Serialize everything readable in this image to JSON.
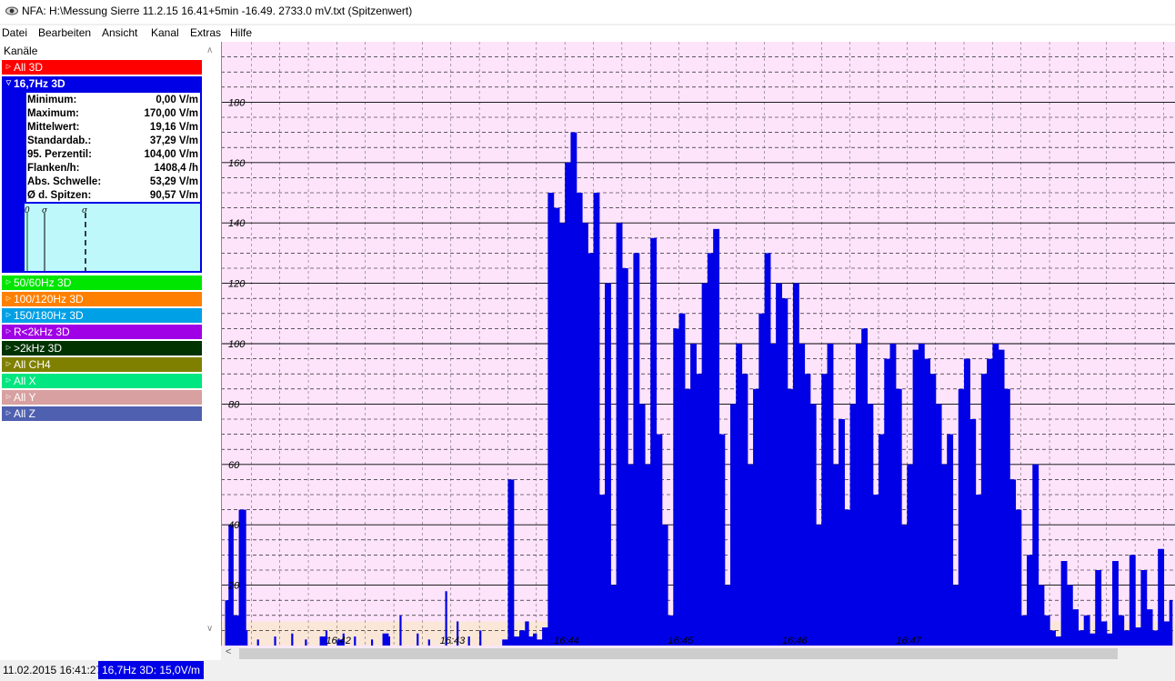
{
  "window": {
    "title": "NFA: H:\\Messung Sierre 11.2.15 16.41+5min -16.49. 2733.0 mV.txt (Spitzenwert)"
  },
  "menu": [
    "Datei",
    "Bearbeiten",
    "Ansicht",
    "Kanal",
    "Extras",
    "Hilfe"
  ],
  "panel": {
    "title": "Kanäle"
  },
  "channels": [
    {
      "label": "All 3D",
      "color": "#ff0000",
      "text_color": "#ffffff",
      "expanded": false
    },
    {
      "label": "16,7Hz 3D",
      "color": "#0000e6",
      "text_color": "#ffffff",
      "expanded": true
    },
    {
      "label": "50/60Hz 3D",
      "color": "#00e600",
      "text_color": "#ffffff",
      "expanded": false
    },
    {
      "label": "100/120Hz 3D",
      "color": "#ff8000",
      "text_color": "#ffffff",
      "expanded": false
    },
    {
      "label": "150/180Hz 3D",
      "color": "#00a0e6",
      "text_color": "#ffffff",
      "expanded": false
    },
    {
      "label": "R<2kHz 3D",
      "color": "#a000e6",
      "text_color": "#ffffff",
      "expanded": false
    },
    {
      "label": ">2kHz 3D",
      "color": "#003300",
      "text_color": "#ffffff",
      "expanded": false
    },
    {
      "label": "All CH4",
      "color": "#808000",
      "text_color": "#ffffff",
      "expanded": false
    },
    {
      "label": "All X",
      "color": "#00e680",
      "text_color": "#ffffff",
      "expanded": false
    },
    {
      "label": "All Y",
      "color": "#d8a0a0",
      "text_color": "#ffffff",
      "expanded": false
    },
    {
      "label": "All Z",
      "color": "#5060b0",
      "text_color": "#ffffff",
      "expanded": false
    }
  ],
  "stats": [
    {
      "label": "Minimum:",
      "value": "0,00 V/m"
    },
    {
      "label": "Maximum:",
      "value": "170,00 V/m"
    },
    {
      "label": "Mittelwert:",
      "value": "19,16 V/m"
    },
    {
      "label": "Standardab.:",
      "value": "37,29 V/m"
    },
    {
      "label": "95. Perzentil:",
      "value": "104,00 V/m"
    },
    {
      "label": "Flanken/h:",
      "value": "1408,4 /h"
    },
    {
      "label": "Abs. Schwelle:",
      "value": "53,29 V/m"
    },
    {
      "label": "Ø d. Spitzen:",
      "value": "90,57 V/m"
    }
  ],
  "histogram_labels": [
    "0",
    "σ",
    "σ"
  ],
  "chart_data": {
    "type": "area",
    "title": "",
    "xlabel": "",
    "ylabel": "",
    "ylim": [
      0,
      200
    ],
    "yticks": [
      20,
      40,
      60,
      80,
      100,
      120,
      140,
      160,
      180
    ],
    "xticks": [
      "16:42",
      "16:43",
      "16:44",
      "16:45",
      "16:46",
      "16:47"
    ],
    "series": [
      {
        "name": "16,7Hz 3D",
        "color": "#0000e6",
        "x_minutes_since_16_41": [
          0.02,
          0.05,
          0.09,
          0.14,
          0.2,
          0.3,
          0.45,
          0.6,
          0.72,
          0.85,
          0.9,
          1.0,
          1.05,
          1.15,
          1.3,
          1.4,
          1.45,
          1.55,
          1.7,
          1.8,
          1.95,
          2.05,
          2.15,
          2.25,
          2.45,
          2.5,
          2.55,
          2.6,
          2.65,
          2.68,
          2.72,
          2.75,
          2.8,
          2.85,
          2.9,
          2.95,
          3.0,
          3.05,
          3.1,
          3.15,
          3.2,
          3.25,
          3.3,
          3.35,
          3.4,
          3.45,
          3.5,
          3.55,
          3.6,
          3.65,
          3.7,
          3.75,
          3.8,
          3.85,
          3.9,
          3.95,
          4.0,
          4.05,
          4.1,
          4.15,
          4.2,
          4.25,
          4.3,
          4.35,
          4.4,
          4.45,
          4.5,
          4.55,
          4.6,
          4.65,
          4.7,
          4.75,
          4.8,
          4.85,
          4.9,
          4.95,
          5.0,
          5.05,
          5.1,
          5.15,
          5.2,
          5.25,
          5.3,
          5.35,
          5.4,
          5.45,
          5.5,
          5.55,
          5.6,
          5.65,
          5.7,
          5.75,
          5.8,
          5.85,
          5.9,
          5.95,
          6.0,
          6.05,
          6.1,
          6.15,
          6.2,
          6.25,
          6.3,
          6.35,
          6.4,
          6.45,
          6.5,
          6.55,
          6.6,
          6.65,
          6.7,
          6.75,
          6.8,
          6.85,
          6.9,
          6.95,
          7.0,
          7.05,
          7.1,
          7.15,
          7.2,
          7.25,
          7.3,
          7.35,
          7.4,
          7.45,
          7.5,
          7.55,
          7.6,
          7.65,
          7.7,
          7.75,
          7.8,
          7.85,
          7.9,
          7.95,
          8.0,
          8.05,
          8.1,
          8.15,
          8.2,
          8.25,
          8.3
        ],
        "y": [
          15,
          40,
          10,
          45,
          5,
          2,
          3,
          4,
          2,
          3,
          5,
          2,
          4,
          3,
          2,
          4,
          3,
          10,
          4,
          2,
          18,
          8,
          3,
          5,
          2,
          55,
          3,
          5,
          8,
          3,
          4,
          2,
          6,
          150,
          145,
          140,
          160,
          170,
          150,
          140,
          130,
          150,
          50,
          120,
          20,
          140,
          125,
          60,
          130,
          80,
          60,
          135,
          70,
          40,
          10,
          105,
          110,
          85,
          100,
          90,
          120,
          130,
          138,
          70,
          20,
          80,
          100,
          90,
          60,
          85,
          110,
          130,
          100,
          120,
          115,
          85,
          120,
          100,
          90,
          80,
          40,
          90,
          100,
          60,
          75,
          45,
          80,
          100,
          105,
          80,
          50,
          70,
          95,
          100,
          85,
          40,
          60,
          98,
          100,
          95,
          90,
          80,
          60,
          70,
          20,
          85,
          95,
          75,
          50,
          90,
          95,
          100,
          98,
          85,
          55,
          45,
          10,
          30,
          60,
          20,
          10,
          5,
          3,
          28,
          20,
          12,
          5,
          10,
          4,
          25,
          8,
          4,
          28,
          10,
          5,
          30,
          6,
          25,
          12,
          5,
          32,
          8,
          15,
          3
        ]
      }
    ]
  }
}
